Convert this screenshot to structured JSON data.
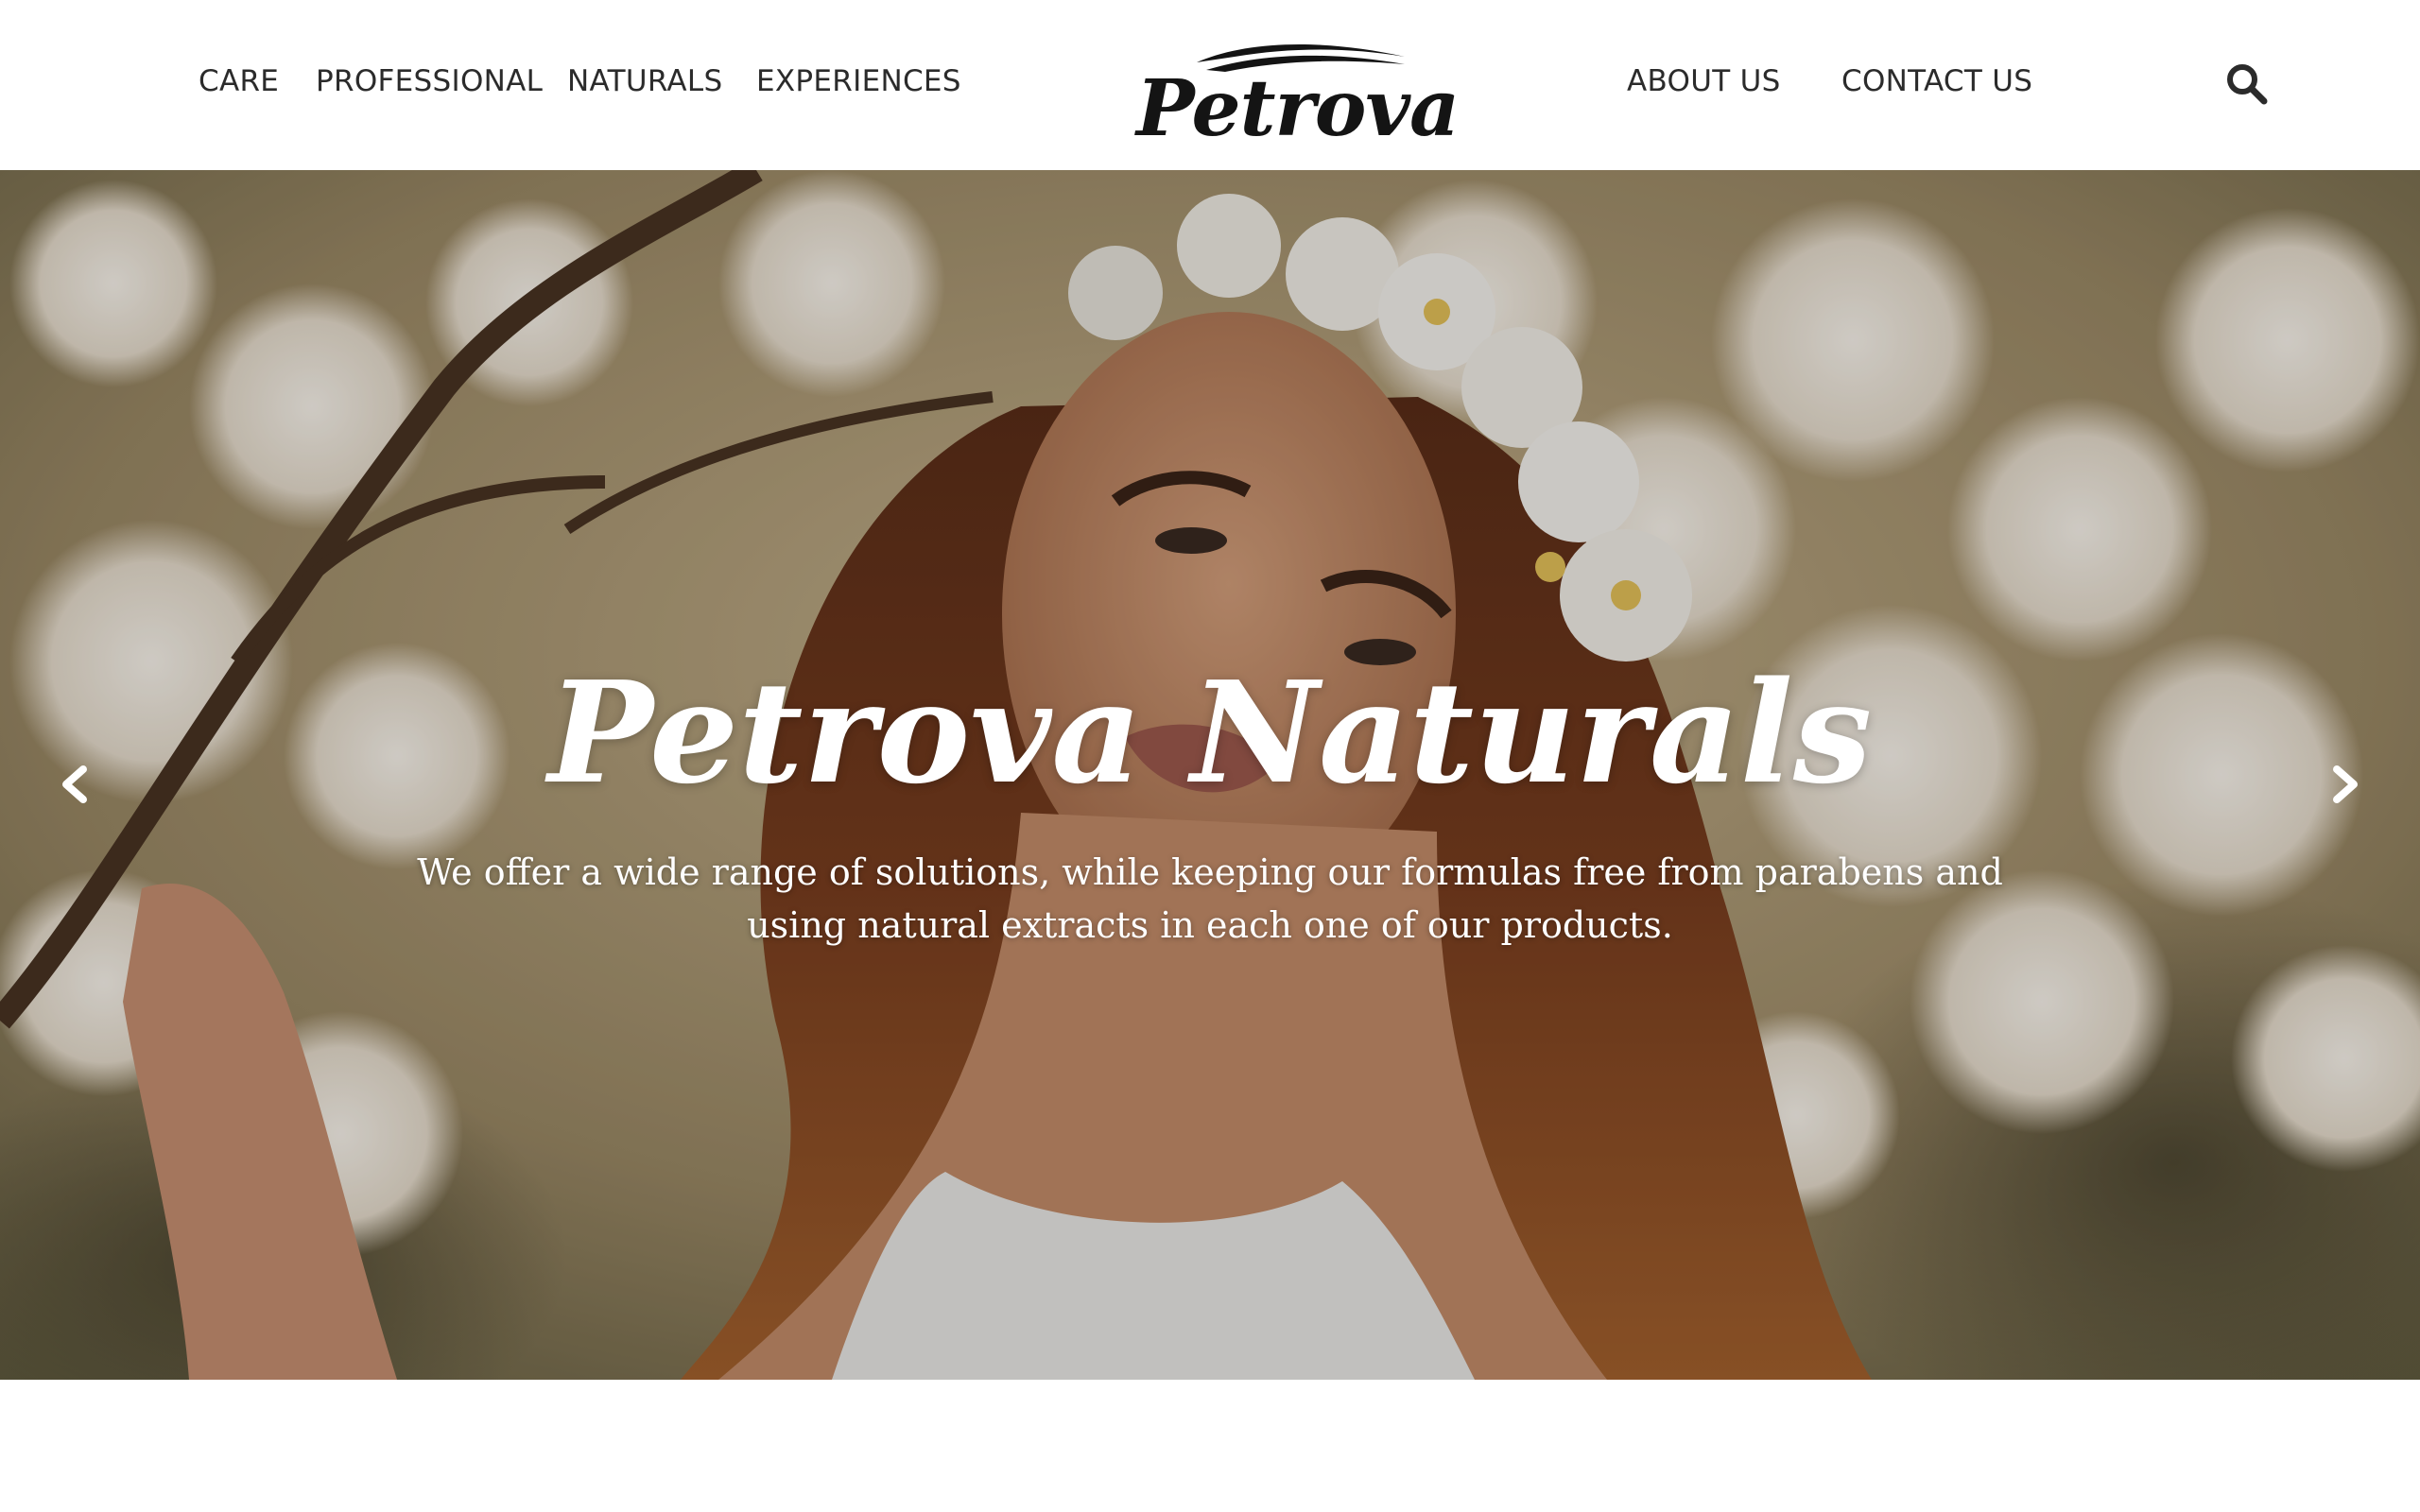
{
  "nav": {
    "left": [
      "CARE",
      "PROFESSIONAL",
      "NATURALS",
      "EXPERIENCES"
    ],
    "right": [
      "ABOUT US",
      "CONTACT US"
    ]
  },
  "brand": {
    "logo_text": "Petrova"
  },
  "search": {
    "icon": "search-icon"
  },
  "hero": {
    "title": "Petrova Naturals",
    "subtitle": "We offer a wide range of solutions, while keeping our formulas free from parabens and using natural extracts in each one of our products.",
    "prev_icon": "chevron-left-icon",
    "next_icon": "chevron-right-icon"
  },
  "colors": {
    "nav_text": "#2b2b2b",
    "logo": "#141414",
    "hero_text": "#ffffff",
    "header_bg": "#ffffff"
  }
}
